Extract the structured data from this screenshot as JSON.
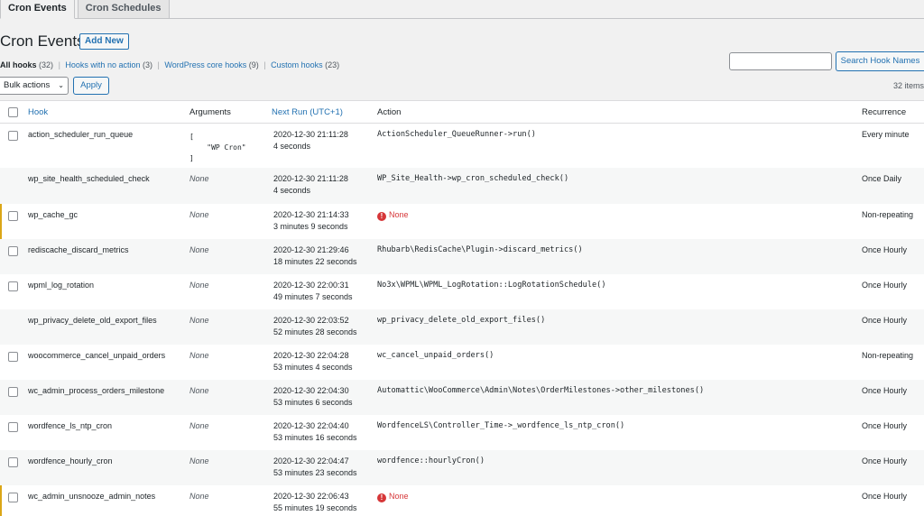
{
  "tabs": [
    "Cron Events",
    "Cron Schedules"
  ],
  "page_title": "Cron Events",
  "add_new": "Add New",
  "filters": [
    {
      "label": "All hooks",
      "count": "(32)"
    },
    {
      "label": "Hooks with no action",
      "count": "(3)"
    },
    {
      "label": "WordPress core hooks",
      "count": "(9)"
    },
    {
      "label": "Custom hooks",
      "count": "(23)"
    }
  ],
  "filter_separator": "|",
  "search": {
    "value": "",
    "button": "Search Hook Names"
  },
  "bulk": {
    "label": "Bulk actions",
    "apply": "Apply"
  },
  "items_count": "32 items",
  "columns": {
    "hook": "Hook",
    "arguments": "Arguments",
    "next_run": "Next Run (UTC+1)",
    "action": "Action",
    "recurrence": "Recurrence"
  },
  "rows": [
    {
      "hook": "action_scheduler_run_queue",
      "args_lines": [
        "[",
        "    \"WP Cron\"",
        "]"
      ],
      "next_run": "2020-12-30 21:11:28",
      "next_in": "4 seconds",
      "action": "ActionScheduler_QueueRunner->run()",
      "recurrence": "Every minute",
      "checkbox": true,
      "warn": false
    },
    {
      "hook": "wp_site_health_scheduled_check",
      "args": "None",
      "next_run": "2020-12-30 21:11:28",
      "next_in": "4 seconds",
      "action": "WP_Site_Health->wp_cron_scheduled_check()",
      "recurrence": "Once Daily",
      "checkbox": false,
      "warn": false
    },
    {
      "hook": "wp_cache_gc",
      "args": "None",
      "next_run": "2020-12-30 21:14:33",
      "next_in": "3 minutes 9 seconds",
      "action_none": "None",
      "recurrence": "Non-repeating",
      "checkbox": true,
      "warn": true
    },
    {
      "hook": "rediscache_discard_metrics",
      "args": "None",
      "next_run": "2020-12-30 21:29:46",
      "next_in": "18 minutes 22 seconds",
      "action": "Rhubarb\\RedisCache\\Plugin->discard_metrics()",
      "recurrence": "Once Hourly",
      "checkbox": true,
      "warn": false
    },
    {
      "hook": "wpml_log_rotation",
      "args": "None",
      "next_run": "2020-12-30 22:00:31",
      "next_in": "49 minutes 7 seconds",
      "action": "No3x\\WPML\\WPML_LogRotation::LogRotationSchedule()",
      "recurrence": "Once Hourly",
      "checkbox": true,
      "warn": false
    },
    {
      "hook": "wp_privacy_delete_old_export_files",
      "args": "None",
      "next_run": "2020-12-30 22:03:52",
      "next_in": "52 minutes 28 seconds",
      "action": "wp_privacy_delete_old_export_files()",
      "recurrence": "Once Hourly",
      "checkbox": false,
      "warn": false
    },
    {
      "hook": "woocommerce_cancel_unpaid_orders",
      "args": "None",
      "next_run": "2020-12-30 22:04:28",
      "next_in": "53 minutes 4 seconds",
      "action": "wc_cancel_unpaid_orders()",
      "recurrence": "Non-repeating",
      "checkbox": true,
      "warn": false
    },
    {
      "hook": "wc_admin_process_orders_milestone",
      "args": "None",
      "next_run": "2020-12-30 22:04:30",
      "next_in": "53 minutes 6 seconds",
      "action": "Automattic\\WooCommerce\\Admin\\Notes\\OrderMilestones->other_milestones()",
      "recurrence": "Once Hourly",
      "checkbox": true,
      "warn": false
    },
    {
      "hook": "wordfence_ls_ntp_cron",
      "args": "None",
      "next_run": "2020-12-30 22:04:40",
      "next_in": "53 minutes 16 seconds",
      "action": "WordfenceLS\\Controller_Time->_wordfence_ls_ntp_cron()",
      "recurrence": "Once Hourly",
      "checkbox": true,
      "warn": false
    },
    {
      "hook": "wordfence_hourly_cron",
      "args": "None",
      "next_run": "2020-12-30 22:04:47",
      "next_in": "53 minutes 23 seconds",
      "action": "wordfence::hourlyCron()",
      "recurrence": "Once Hourly",
      "checkbox": true,
      "warn": false
    },
    {
      "hook": "wc_admin_unsnooze_admin_notes",
      "args": "None",
      "next_run": "2020-12-30 22:06:43",
      "next_in": "55 minutes 19 seconds",
      "action_none": "None",
      "recurrence": "Once Hourly",
      "checkbox": true,
      "warn": true
    }
  ]
}
